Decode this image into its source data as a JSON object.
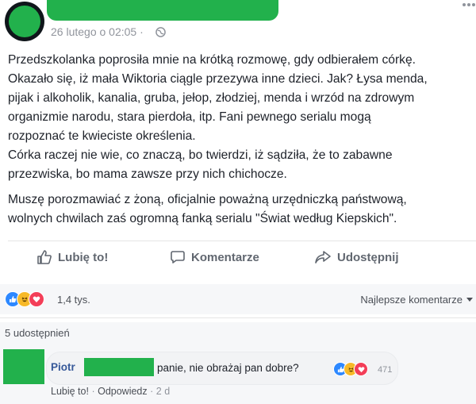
{
  "post": {
    "timestamp": "26 lutego o 02:05 ·",
    "paragraphs": [
      "Przedszkolanka poprosiła mnie na krótką rozmowę, gdy odbierałem córkę.",
      "Okazało się, iż mała Wiktoria ciągle przezywa inne dzieci. Jak? Łysa menda,",
      "pijak i alkoholik, kanalia, gruba, jełop, złodziej, menda i wrzód na zdrowym",
      "organizmie narodu, stara pierdoła, itp. Fani pewnego serialu mogą",
      "rozpoznać te kwieciste określenia.",
      "Córka raczej nie wie, co znaczą, bo twierdzi, iż sądziła, że to zabawne",
      "przezwiska, bo mama zawsze przy nich chichocze.",
      "Muszę porozmawiać z żoną, oficjalnie poważną urzędniczką państwową,",
      "wolnych chwilach zaś ogromną fanką serialu \"Świat według Kiepskich\"."
    ]
  },
  "actions": {
    "like": "Lubię to!",
    "comment": "Komentarze",
    "share": "Udostępnij"
  },
  "summary": {
    "reaction_count": "1,4 tys.",
    "sort_label": "Najlepsze komentarze"
  },
  "shares": "5 udostępnień",
  "comment": {
    "author": "Piotr",
    "text": "panie, nie obrażaj pan dobre?",
    "reaction_count": "471",
    "like": "Lubię to!",
    "reply": "Odpowiedz",
    "age": "2 d"
  },
  "colors": {
    "redaction": "#22b14c",
    "link_blue": "#365899",
    "muted": "#90949c"
  },
  "icons": [
    "globe-icon",
    "more-icon",
    "like-icon",
    "comment-icon",
    "share-icon",
    "caret-down-icon"
  ]
}
